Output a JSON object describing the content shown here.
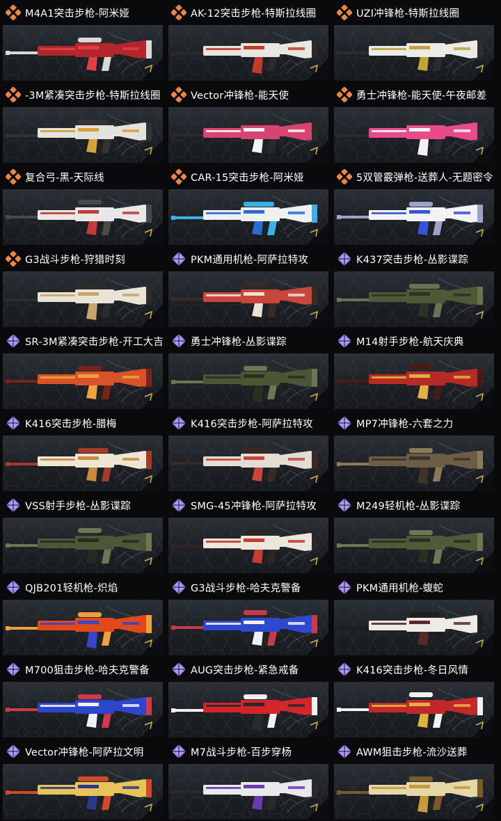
{
  "colors": {
    "legendary": "#e8864a",
    "epic": "#a78bfa",
    "background": "#0a0a0c",
    "card_top": "#2b3036",
    "card_bottom": "#171a1e"
  },
  "items": [
    {
      "name": "M4A1突击步枪-阿米娅",
      "rarity": "legendary",
      "icon": "diamond-cluster-icon",
      "skin": [
        "#b3262b",
        "#e04045",
        "#d9d9d9"
      ]
    },
    {
      "name": "AK-12突击步枪-特斯拉线圈",
      "rarity": "legendary",
      "icon": "diamond-cluster-icon",
      "skin": [
        "#e8e6e0",
        "#c23a2a",
        "#2a2a2a"
      ]
    },
    {
      "name": "UZI冲锋枪-特斯拉线圈",
      "rarity": "legendary",
      "icon": "diamond-cluster-icon",
      "skin": [
        "#ecebe6",
        "#c0a53a",
        "#2d2d2d"
      ]
    },
    {
      "name": "-3M紧凑突击步枪-特斯拉线圈",
      "rarity": "legendary",
      "icon": "diamond-cluster-icon",
      "skin": [
        "#e4e2dc",
        "#d8a03a",
        "#333333"
      ]
    },
    {
      "name": "Vector冲锋枪-能天使",
      "rarity": "legendary",
      "icon": "diamond-cluster-icon",
      "skin": [
        "#d84373",
        "#f3f3f3",
        "#2a2a2a"
      ]
    },
    {
      "name": "勇士冲锋枪-能天使-午夜邮差",
      "rarity": "legendary",
      "icon": "diamond-cluster-icon",
      "skin": [
        "#e84a8a",
        "#f2f2f2",
        "#2c2c2c"
      ]
    },
    {
      "name": "复合弓-黑-天际线",
      "rarity": "legendary",
      "icon": "diamond-cluster-icon",
      "skin": [
        "#e8e8e8",
        "#c43a3a",
        "#4a4a4a"
      ]
    },
    {
      "name": "CAR-15突击步枪-阿米娅",
      "rarity": "legendary",
      "icon": "diamond-cluster-icon",
      "skin": [
        "#f0f0f0",
        "#2b6cd4",
        "#3ab2e6"
      ]
    },
    {
      "name": "5双管霰弹枪-送葬人-无题密令",
      "rarity": "legendary",
      "icon": "diamond-cluster-icon",
      "skin": [
        "#f3f3f6",
        "#3754d6",
        "#9aa3c8"
      ]
    },
    {
      "name": "G3战斗步枪-狩猎时刻",
      "rarity": "legendary",
      "icon": "diamond-cluster-icon",
      "skin": [
        "#e9e4d7",
        "#c8a66a",
        "#2c2c2c"
      ]
    },
    {
      "name": "PKM通用机枪-阿萨拉特攻",
      "rarity": "epic",
      "icon": "purple-diamond-icon",
      "skin": [
        "#c9473a",
        "#eae1d4",
        "#3a2a25"
      ]
    },
    {
      "name": "K437突击步枪-丛影谍踪",
      "rarity": "epic",
      "icon": "purple-diamond-icon",
      "skin": [
        "#4d5a3a",
        "#2d3324",
        "#6b7252"
      ]
    },
    {
      "name": "SR-3M紧凑突击步枪-开工大吉",
      "rarity": "epic",
      "icon": "purple-diamond-icon",
      "skin": [
        "#d9532a",
        "#f0a040",
        "#7a2418"
      ]
    },
    {
      "name": "勇士冲锋枪-丛影谍踪",
      "rarity": "epic",
      "icon": "purple-diamond-icon",
      "skin": [
        "#4c5636",
        "#2a2f20",
        "#6f7550"
      ]
    },
    {
      "name": "M14射手步枪-航天庆典",
      "rarity": "epic",
      "icon": "purple-diamond-icon",
      "skin": [
        "#b82a26",
        "#e0b040",
        "#4a1a16"
      ]
    },
    {
      "name": "K416突击步枪-腊梅",
      "rarity": "epic",
      "icon": "purple-diamond-icon",
      "skin": [
        "#eee6d4",
        "#c98a3a",
        "#a43a2a"
      ]
    },
    {
      "name": "K416突击步枪-阿萨拉特攻",
      "rarity": "epic",
      "icon": "purple-diamond-icon",
      "skin": [
        "#e3ddd4",
        "#c8453a",
        "#3a2a26"
      ]
    },
    {
      "name": "MP7冲锋枪-六套之力",
      "rarity": "epic",
      "icon": "purple-diamond-icon",
      "skin": [
        "#6b5e44",
        "#3c3428",
        "#8a7a58"
      ]
    },
    {
      "name": "VSS射手步枪-丛影谍踪",
      "rarity": "epic",
      "icon": "purple-diamond-icon",
      "skin": [
        "#4d5636",
        "#272b1f",
        "#717652"
      ]
    },
    {
      "name": "SMG-45冲锋枪-阿萨拉特攻",
      "rarity": "epic",
      "icon": "purple-diamond-icon",
      "skin": [
        "#ece6dc",
        "#c63c34",
        "#2e2624"
      ]
    },
    {
      "name": "M249轻机枪-丛影谍踪",
      "rarity": "epic",
      "icon": "purple-diamond-icon",
      "skin": [
        "#4f5a38",
        "#2a2f20",
        "#707552"
      ]
    },
    {
      "name": "QJB201轻机枪-炽焰",
      "rarity": "epic",
      "icon": "purple-diamond-icon",
      "skin": [
        "#e04a1a",
        "#3a44c8",
        "#f0a03a"
      ]
    },
    {
      "name": "G3战斗步枪-哈夫克警备",
      "rarity": "epic",
      "icon": "purple-diamond-icon",
      "skin": [
        "#2e48d0",
        "#eef0f6",
        "#c83a4a"
      ]
    },
    {
      "name": "PKM通用机枪-蝮蛇",
      "rarity": "epic",
      "icon": "purple-diamond-icon",
      "skin": [
        "#ecebe8",
        "#5a2a2a",
        "#1e1e1e"
      ]
    },
    {
      "name": "M700狙击步枪-哈夫克警备",
      "rarity": "epic",
      "icon": "purple-diamond-icon",
      "skin": [
        "#2d46cc",
        "#eef0f6",
        "#d03a4a"
      ]
    },
    {
      "name": "AUG突击步枪-紧急戒备",
      "rarity": "epic",
      "icon": "purple-diamond-icon",
      "skin": [
        "#d4262a",
        "#2a2a2a",
        "#f0f0f0"
      ]
    },
    {
      "name": "K416突击步枪-冬日风情",
      "rarity": "epic",
      "icon": "purple-diamond-icon",
      "skin": [
        "#c0282a",
        "#e0b040",
        "#f2f2f2"
      ]
    },
    {
      "name": "Vector冲锋枪-阿萨拉文明",
      "rarity": "epic",
      "icon": "purple-diamond-icon",
      "skin": [
        "#e7c45a",
        "#2a3a8a",
        "#d04a2a"
      ]
    },
    {
      "name": "M7战斗步枪-百步穿杨",
      "rarity": "epic",
      "icon": "purple-diamond-icon",
      "skin": [
        "#e9e9ec",
        "#6a3ab0",
        "#2a2a2a"
      ]
    },
    {
      "name": "AWM狙击步枪-流沙送葬",
      "rarity": "epic",
      "icon": "purple-diamond-icon",
      "skin": [
        "#e6d7a8",
        "#c89a40",
        "#7a5a2a"
      ]
    }
  ]
}
